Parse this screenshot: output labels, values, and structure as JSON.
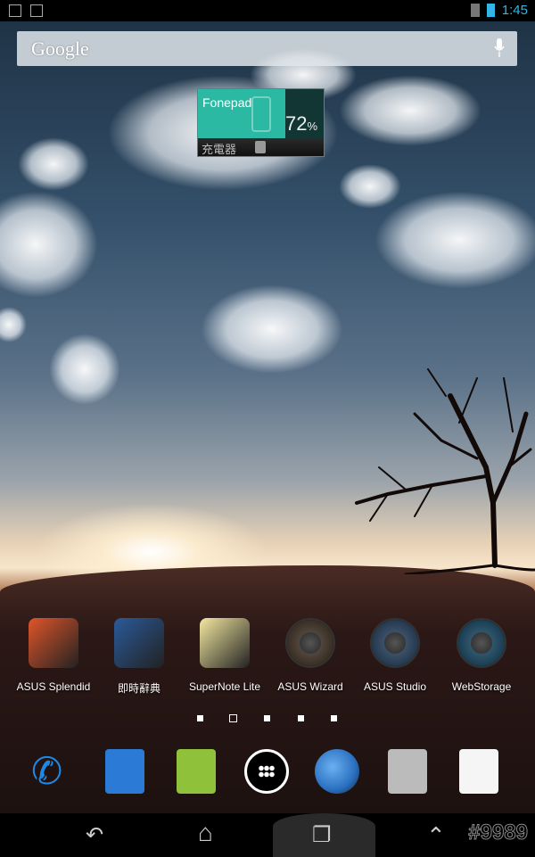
{
  "status_bar": {
    "time": "1:45",
    "left_icons": [
      "notes-icon",
      "image-icon"
    ],
    "right_icons": [
      "sim-unknown-icon",
      "battery-icon"
    ]
  },
  "search": {
    "logo": "Google",
    "mic_icon": "mic-icon"
  },
  "widget": {
    "device": "Fonepad",
    "percent": "72",
    "percent_sign": "%",
    "status": "充電器",
    "battery_level": 72
  },
  "apps": [
    {
      "label": "ASUS Splendid",
      "icon": "splendid-icon",
      "color": "#e0552a"
    },
    {
      "label": "即時辭典",
      "icon": "dictionary-icon",
      "color": "#2a5a9a"
    },
    {
      "label": "SuperNote Lite",
      "icon": "supernote-icon",
      "color": "#f4e8a0"
    },
    {
      "label": "ASUS Wizard",
      "icon": "wizard-icon",
      "color": "#8a6a4a"
    },
    {
      "label": "ASUS Studio",
      "icon": "studio-icon",
      "color": "#4a8ad0"
    },
    {
      "label": "WebStorage",
      "icon": "webstorage-icon",
      "color": "#2a9ad8"
    }
  ],
  "pages": {
    "count": 5,
    "current": 2
  },
  "dock": [
    {
      "name": "phone",
      "icon": "phone-icon",
      "color": "#1e88e5"
    },
    {
      "name": "contacts",
      "icon": "contacts-icon",
      "color": "#2b7bd6"
    },
    {
      "name": "messaging",
      "icon": "messaging-icon",
      "color": "#8fc23a"
    },
    {
      "name": "all-apps",
      "icon": "app-drawer-icon",
      "color": "#000000"
    },
    {
      "name": "browser",
      "icon": "globe-icon",
      "color": "#2a70c0"
    },
    {
      "name": "camera",
      "icon": "camera-icon",
      "color": "#bbbbbb"
    },
    {
      "name": "play-store",
      "icon": "play-store-icon",
      "color": "#f5f5f5"
    }
  ],
  "nav": {
    "back": "↶",
    "home": "⌂",
    "recents": "❐",
    "menu": "⌃",
    "tag": "#9989"
  }
}
